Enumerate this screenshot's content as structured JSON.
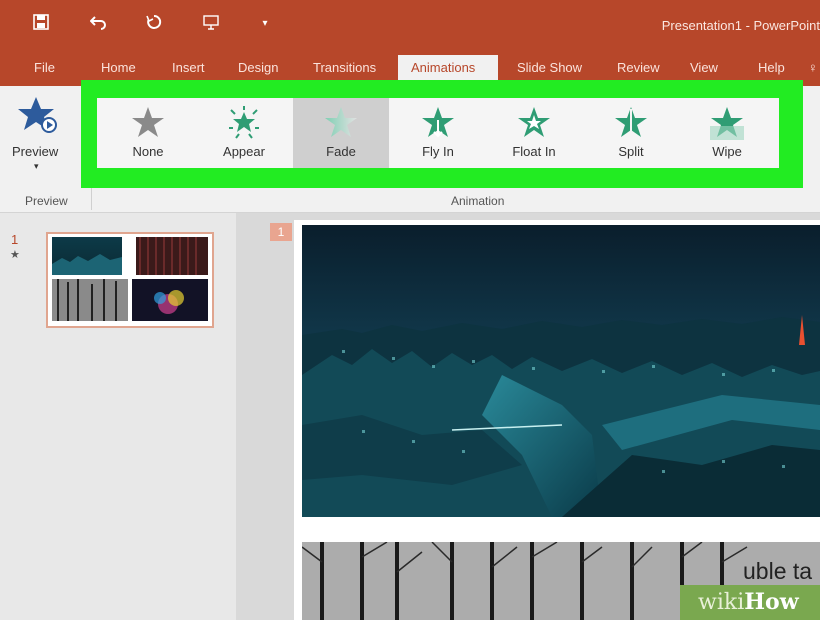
{
  "window": {
    "title": "Presentation1 - PowerPoint"
  },
  "quick_access": [
    "save-icon",
    "undo-icon",
    "redo-icon",
    "start-from-beginning-icon",
    "customize-icon"
  ],
  "tabs": [
    "File",
    "Home",
    "Insert",
    "Design",
    "Transitions",
    "Animations",
    "Slide Show",
    "Review",
    "View",
    "Help"
  ],
  "active_tab": "Animations",
  "ribbon": {
    "preview_label": "Preview",
    "preview_group": "Preview",
    "animation_group": "Animation",
    "animations": [
      "None",
      "Appear",
      "Fade",
      "Fly In",
      "Float In",
      "Split",
      "Wipe"
    ],
    "selected_animation": "Fade"
  },
  "thumbnails": {
    "slide_number": "1",
    "animation_marker": "★"
  },
  "slide": {
    "number": "1",
    "title_fragment": "uble ta"
  },
  "watermark": {
    "wiki": "wiki",
    "how": "How"
  },
  "colors": {
    "accent": "#b7472a",
    "highlight": "#22ec22",
    "star_gray": "#888888",
    "star_green": "#3aa07a"
  }
}
